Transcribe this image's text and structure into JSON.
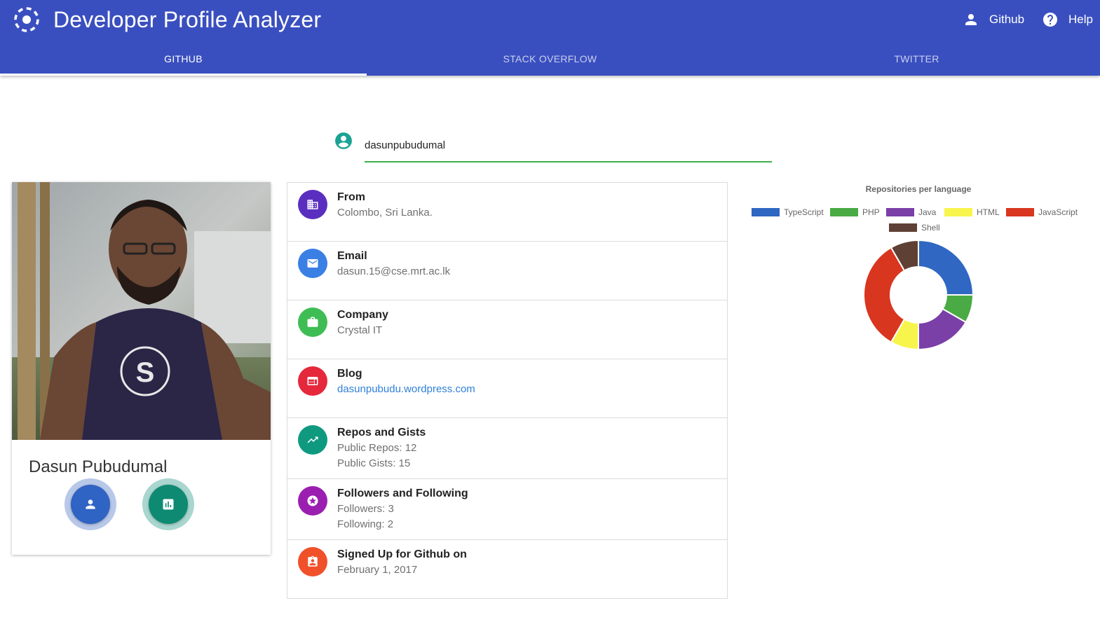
{
  "app": {
    "title": "Developer Profile Analyzer",
    "actions": [
      {
        "label": "Github",
        "icon": "person-icon"
      },
      {
        "label": "Help",
        "icon": "help-icon"
      }
    ],
    "tabs": [
      {
        "label": "GITHUB",
        "active": true
      },
      {
        "label": "STACK OVERFLOW",
        "active": false
      },
      {
        "label": "TWITTER",
        "active": false
      }
    ],
    "colors": {
      "primary": "#3a4fbf",
      "input_underline": "#3fae49"
    }
  },
  "search": {
    "value": "dasunpubudumal"
  },
  "profile": {
    "name": "Dasun Pubudumal",
    "buttons": [
      {
        "icon": "person-icon",
        "color": "#2f63c4"
      },
      {
        "icon": "bar-chart-icon",
        "color": "#0e8a72"
      }
    ]
  },
  "info": [
    {
      "title": "From",
      "lines": [
        "Colombo, Sri Lanka."
      ],
      "icon": "business-icon",
      "color": "#5a2fbf"
    },
    {
      "title": "Email",
      "lines": [
        "dasun.15@cse.mrt.ac.lk"
      ],
      "icon": "email-icon",
      "color": "#3a7fe4"
    },
    {
      "title": "Company",
      "lines": [
        "Crystal IT"
      ],
      "icon": "briefcase-icon",
      "color": "#3fbd55"
    },
    {
      "title": "Blog",
      "lines": [
        "dasunpubudu.wordpress.com"
      ],
      "icon": "web-icon",
      "color": "#e5283c",
      "link": true
    },
    {
      "title": "Repos and Gists",
      "lines": [
        "Public Repos: 12",
        "Public Gists: 15"
      ],
      "icon": "trending-up-icon",
      "color": "#0f9a80"
    },
    {
      "title": "Followers and Following",
      "lines": [
        "Followers: 3",
        "Following: 2"
      ],
      "icon": "stars-icon",
      "color": "#9a1fb0"
    },
    {
      "title": "Signed Up for Github on",
      "lines": [
        "February 1, 2017"
      ],
      "icon": "contact-icon",
      "color": "#f0512a"
    }
  ],
  "chart_data": {
    "type": "pie",
    "variant": "doughnut",
    "title": "Repositories per language",
    "categories": [
      "TypeScript",
      "PHP",
      "Java",
      "HTML",
      "JavaScript",
      "Shell"
    ],
    "values": [
      3,
      1,
      2,
      1,
      4,
      1
    ],
    "colors": [
      "#2f67c2",
      "#4aaa44",
      "#7b3fa8",
      "#f7f54b",
      "#d9361f",
      "#5f4035"
    ],
    "legend": "top"
  }
}
